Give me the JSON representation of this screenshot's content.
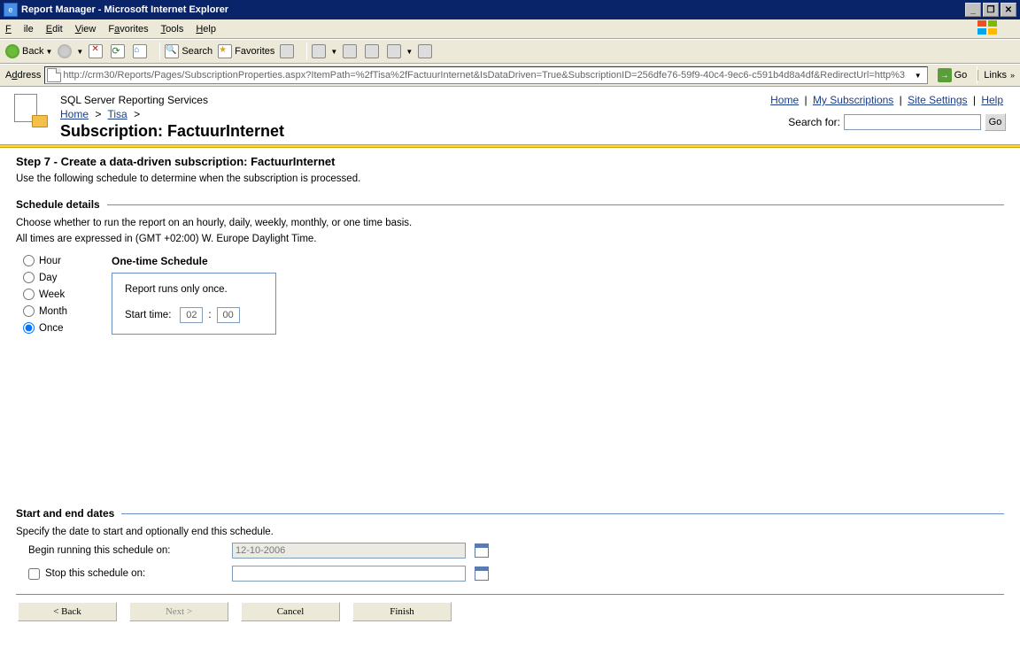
{
  "titlebar": {
    "title": "Report Manager - Microsoft Internet Explorer"
  },
  "menubar": {
    "file": "File",
    "edit": "Edit",
    "view": "View",
    "favorites": "Favorites",
    "tools": "Tools",
    "help": "Help"
  },
  "toolbar": {
    "back": "Back",
    "search": "Search",
    "favorites": "Favorites"
  },
  "addressbar": {
    "label": "Address",
    "url": "http://crm30/Reports/Pages/SubscriptionProperties.aspx?ItemPath=%2fTisa%2fFactuurInternet&IsDataDriven=True&SubscriptionID=256dfe76-59f9-40c4-9ec6-c591b4d8a4df&RedirectUrl=http%3",
    "go": "Go",
    "links": "Links"
  },
  "header": {
    "service": "SQL Server Reporting Services",
    "crumb_home": "Home",
    "crumb_tisa": "Tisa",
    "crumb_sep": ">",
    "page_title": "Subscription: FactuurInternet",
    "nav_home": "Home",
    "nav_mysubs": "My Subscriptions",
    "nav_sitesettings": "Site Settings",
    "nav_help": "Help",
    "search_label": "Search for:",
    "search_value": "",
    "go": "Go"
  },
  "step": {
    "title": "Step 7 - Create a data-driven subscription: FactuurInternet",
    "desc": "Use the following schedule to determine when the subscription is processed."
  },
  "schedule": {
    "title": "Schedule details",
    "sub1": "Choose whether to run the report on an hourly, daily, weekly, monthly, or one time basis.",
    "sub2": "All times are expressed in (GMT +02:00) W. Europe Daylight Time.",
    "options": {
      "hour": "Hour",
      "day": "Day",
      "week": "Week",
      "month": "Month",
      "once": "Once"
    },
    "selected": "once",
    "onetime": {
      "head": "One-time Schedule",
      "runs": "Report runs only once.",
      "start_label": "Start time:",
      "hour": "02",
      "minute": "00"
    }
  },
  "dates": {
    "title": "Start and end dates",
    "desc": "Specify the date to start and optionally end this schedule.",
    "begin_label": "Begin running this schedule on:",
    "begin_value": "12-10-2006",
    "stop_label": "Stop this schedule on:",
    "stop_checked": false,
    "stop_value": ""
  },
  "buttons": {
    "back": "< Back",
    "next": "Next >",
    "cancel": "Cancel",
    "finish": "Finish"
  }
}
